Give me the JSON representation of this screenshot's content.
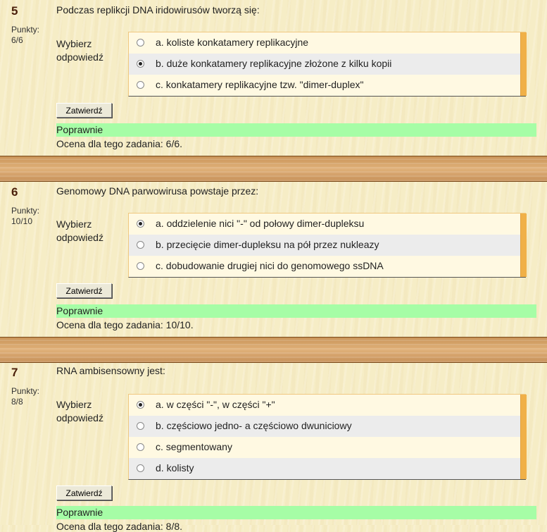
{
  "common": {
    "points_label": "Punkty:",
    "prompt_line1": "Wybierz",
    "prompt_line2": "odpowiedź",
    "submit_label": "Zatwierdź",
    "correct_label": "Poprawnie"
  },
  "questions": [
    {
      "number": "5",
      "points": "6/6",
      "text": "Podczas replikcji DNA iridowirusów tworzą się:",
      "options": [
        {
          "label": "a. koliste konkatamery replikacyjne",
          "selected": false
        },
        {
          "label": "b. duże konkatamery replikacyjne złożone z kilku kopii",
          "selected": true
        },
        {
          "label": "c. konkatamery replikacyjne tzw. \"dimer-duplex\"",
          "selected": false
        }
      ],
      "grade": "Ocena dla tego zadania: 6/6."
    },
    {
      "number": "6",
      "points": "10/10",
      "text": "Genomowy DNA parwowirusa powstaje przez:",
      "options": [
        {
          "label": "a. oddzielenie nici \"-\" od połowy dimer-dupleksu",
          "selected": true
        },
        {
          "label": "b. przecięcie dimer-dupleksu na pół przez nukleazy",
          "selected": false
        },
        {
          "label": "c. dobudowanie drugiej nici do genomowego ssDNA",
          "selected": false
        }
      ],
      "grade": "Ocena dla tego zadania: 10/10."
    },
    {
      "number": "7",
      "points": "8/8",
      "text": "RNA ambisensowny jest:",
      "options": [
        {
          "label": "a. w części \"-\", w części \"+\"",
          "selected": true
        },
        {
          "label": "b. częściowo jedno- a częściowo dwuniciowy",
          "selected": false
        },
        {
          "label": "c. segmentowany",
          "selected": false
        },
        {
          "label": "d. kolisty",
          "selected": false
        }
      ],
      "grade": "Ocena dla tego zadania: 8/8."
    }
  ]
}
